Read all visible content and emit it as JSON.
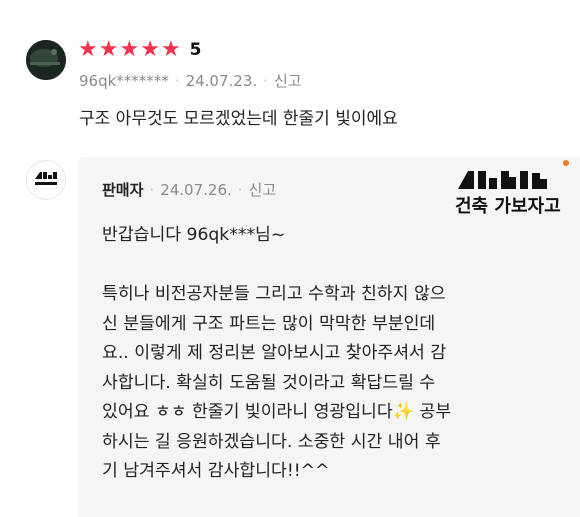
{
  "review": {
    "rating": 5,
    "rating_label": "5",
    "stars": [
      "★",
      "★",
      "★",
      "★",
      "★"
    ],
    "reviewer": "96qk*******",
    "date": "24.07.23.",
    "report_label": "신고",
    "text": "구조 아무것도 모르겠었는데 한줄기 빛이에요"
  },
  "reply": {
    "author": "판매자",
    "date": "24.07.26.",
    "report_label": "신고",
    "lines": [
      "반갑습니다 96qk***님~",
      "",
      "특히나 비전공자분들 그리고 수학과 친하지 않으",
      "신 분들에게 구조 파트는 많이 막막한 부분인데",
      "요.. 이렇게 제 정리본 알아보시고 찾아주셔서 감",
      "사합니다. 확실히 도움될 것이라고 확답드릴 수",
      "있어요 ㅎㅎ 한줄기 빛이라니 영광입니다✨ 공부",
      "하시는 길 응원하겠습니다. 소중한 시간 내어 후",
      "기 남겨주셔서 감사합니다!!^^"
    ]
  },
  "logo": {
    "text": "건축 가보자고",
    "mark": "ᄼᅠ",
    "colors": {
      "ink": "#111111",
      "dot": "#f07a2b"
    }
  },
  "colors": {
    "star": "#f2354d",
    "meta": "#8a8a8a",
    "reply_bg": "#f5f5f5"
  }
}
